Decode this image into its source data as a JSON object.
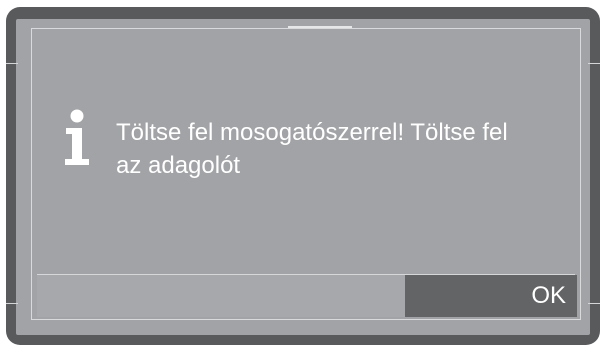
{
  "dialog": {
    "icon": "info-icon",
    "message_line1": "Töltse fel mosogatószerrel! Töltse fel",
    "message_line2": "az adagolót",
    "ok_label": "OK"
  },
  "colors": {
    "frame": "#595a5c",
    "screen": "#a2a3a6",
    "button": "#636466",
    "text": "#ffffff"
  }
}
